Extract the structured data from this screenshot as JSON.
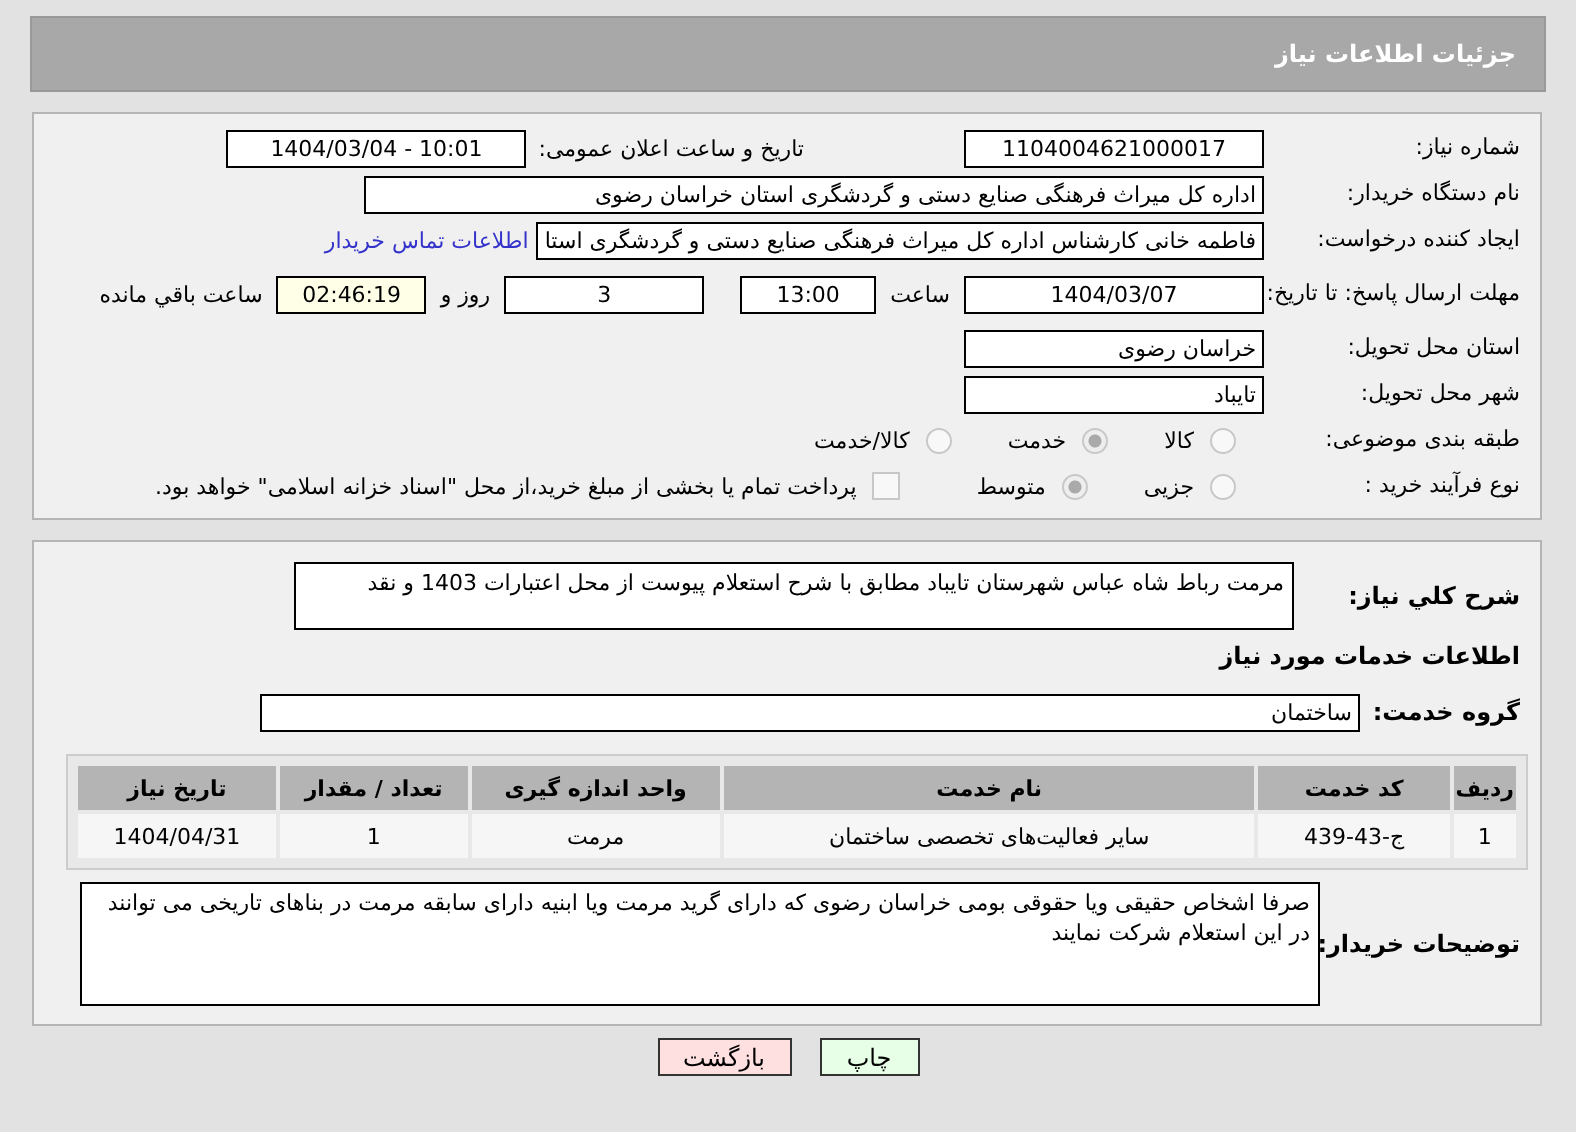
{
  "header": {
    "title": "جزئیات اطلاعات نیاز"
  },
  "details": {
    "need_number": {
      "label": "شماره نیاز:",
      "value": "1104004621000017"
    },
    "announce": {
      "label": "تاریخ و ساعت اعلان عمومی:",
      "value": "1404/03/04 - 10:01"
    },
    "buyer": {
      "label": "نام دستگاه خریدار:",
      "value": "اداره کل میراث فرهنگی  صنایع دستی و گردشگری استان خراسان رضوی"
    },
    "creator": {
      "label": "ایجاد کننده درخواست:",
      "value": "فاطمه خانی کارشناس اداره کل میراث فرهنگی  صنایع دستی و گردشگری استا",
      "link": "اطلاعات تماس خریدار"
    },
    "deadline": {
      "label": "مهلت ارسال پاسخ: تا تاریخ:",
      "date": "1404/03/07",
      "time_label": "ساعت",
      "time": "13:00",
      "days": "3",
      "days_label": "روز و",
      "remaining": "02:46:19",
      "remaining_label": "ساعت باقي مانده"
    },
    "province": {
      "label": "استان محل تحویل:",
      "value": "خراسان رضوی"
    },
    "city": {
      "label": "شهر محل تحویل:",
      "value": "تایباد"
    },
    "category": {
      "label": "طبقه بندی موضوعی:",
      "options": [
        {
          "label": "کالا",
          "selected": false
        },
        {
          "label": "خدمت",
          "selected": true
        },
        {
          "label": "کالا/خدمت",
          "selected": false
        }
      ]
    },
    "process": {
      "label": "نوع فرآیند خرید :",
      "options": [
        {
          "label": "جزیی",
          "selected": false
        },
        {
          "label": "متوسط",
          "selected": true
        }
      ],
      "treasury": {
        "checked": false,
        "label": "پرداخت تمام یا بخشی از مبلغ خرید،از محل \"اسناد خزانه اسلامی\" خواهد بود."
      }
    }
  },
  "description": {
    "label": "شرح كلي نياز:",
    "value": "مرمت رباط شاه عباس شهرستان تایباد مطابق با شرح استعلام پیوست از محل اعتبارات 1403 و نقد"
  },
  "services_heading": "اطلاعات خدمات مورد نیاز",
  "service_group": {
    "label": "گروه خدمت:",
    "value": "ساختمان"
  },
  "table": {
    "columns": [
      "ردیف",
      "کد خدمت",
      "نام خدمت",
      "واحد اندازه گیری",
      "تعداد / مقدار",
      "تاریخ نیاز"
    ],
    "rows": [
      [
        "1",
        "ج-43-439",
        "سایر فعالیت‌های تخصصی ساختمان",
        "مرمت",
        "1",
        "1404/04/31"
      ]
    ]
  },
  "buyer_notes": {
    "label": "توضیحات خریدار:",
    "value": "صرفا اشخاص حقیقی ویا حقوقی  بومی خراسان رضوی که دارای گرید مرمت ویا ابنیه دارای سابقه مرمت در بناهای تاریخی می توانند در این استعلام شرکت نمایند"
  },
  "buttons": [
    {
      "label": "چاپ",
      "color": "#e6ffe6"
    },
    {
      "label": "بازگشت",
      "color": "#ffe0e0"
    }
  ]
}
